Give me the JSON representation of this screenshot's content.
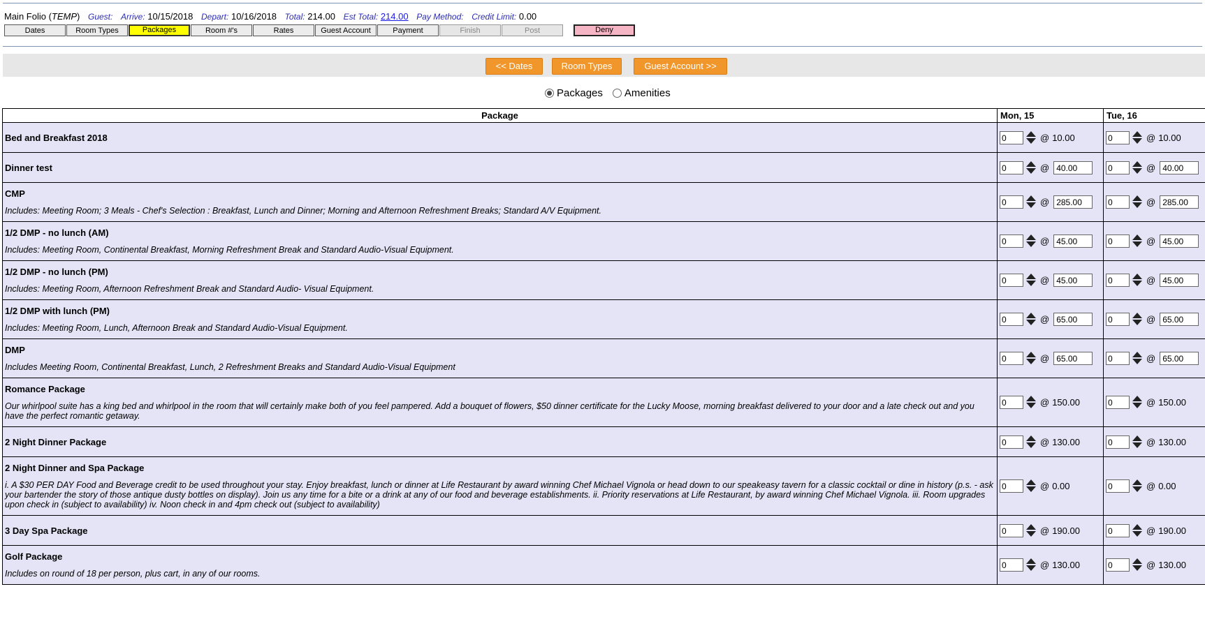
{
  "header": {
    "folio": "Main Folio",
    "folio_type": "TEMP",
    "guest_label": "Guest:",
    "guest_value": "",
    "arrive_label": "Arrive:",
    "arrive_value": "10/15/2018",
    "depart_label": "Depart:",
    "depart_value": "10/16/2018",
    "total_label": "Total:",
    "total_value": "214.00",
    "est_total_label": "Est Total:",
    "est_total_value": "214.00",
    "pay_method_label": "Pay Method:",
    "pay_method_value": "",
    "credit_limit_label": "Credit Limit:",
    "credit_limit_value": "0.00"
  },
  "nav_tabs": [
    {
      "label": "Dates",
      "state": "normal"
    },
    {
      "label": "Room Types",
      "state": "normal"
    },
    {
      "label": "Packages",
      "state": "active"
    },
    {
      "label": "Room #'s",
      "state": "normal"
    },
    {
      "label": "Rates",
      "state": "normal"
    },
    {
      "label": "Guest Account",
      "state": "normal"
    },
    {
      "label": "Payment",
      "state": "normal"
    },
    {
      "label": "Finish",
      "state": "disabled"
    },
    {
      "label": "Post",
      "state": "disabled"
    },
    {
      "label": "Deny",
      "state": "deny"
    }
  ],
  "buttons": {
    "prev": "<< Dates",
    "room_types": "Room Types",
    "next": "Guest Account >>"
  },
  "mode": {
    "options": [
      "Packages",
      "Amenities"
    ],
    "selected": "Packages"
  },
  "table": {
    "columns": [
      "Package",
      "Mon, 15",
      "Tue, 16"
    ],
    "rows": [
      {
        "name": "Bed and Breakfast 2018",
        "desc": "",
        "editable": false,
        "days": [
          {
            "qty": "0",
            "price": "10.00"
          },
          {
            "qty": "0",
            "price": "10.00"
          }
        ]
      },
      {
        "name": "Dinner test",
        "desc": "",
        "editable": true,
        "days": [
          {
            "qty": "0",
            "price": "40.00"
          },
          {
            "qty": "0",
            "price": "40.00"
          }
        ]
      },
      {
        "name": "CMP",
        "desc": "Includes: Meeting Room; 3 Meals - Chef's Selection : Breakfast, Lunch and Dinner; Morning and Afternoon Refreshment Breaks; Standard A/V Equipment.",
        "editable": true,
        "days": [
          {
            "qty": "0",
            "price": "285.00"
          },
          {
            "qty": "0",
            "price": "285.00"
          }
        ]
      },
      {
        "name": "1/2 DMP - no lunch (AM)",
        "desc": "Includes: Meeting Room, Continental Breakfast, Morning Refreshment Break and Standard Audio-Visual Equipment.",
        "editable": true,
        "days": [
          {
            "qty": "0",
            "price": "45.00"
          },
          {
            "qty": "0",
            "price": "45.00"
          }
        ]
      },
      {
        "name": "1/2 DMP - no lunch (PM)",
        "desc": "Includes: Meeting Room, Afternoon Refreshment Break and Standard Audio- Visual Equipment.",
        "editable": true,
        "days": [
          {
            "qty": "0",
            "price": "45.00"
          },
          {
            "qty": "0",
            "price": "45.00"
          }
        ]
      },
      {
        "name": "1/2 DMP with lunch (PM)",
        "desc": "Includes: Meeting Room, Lunch, Afternoon Break and Standard Audio-Visual Equipment.",
        "editable": true,
        "days": [
          {
            "qty": "0",
            "price": "65.00"
          },
          {
            "qty": "0",
            "price": "65.00"
          }
        ]
      },
      {
        "name": "DMP",
        "desc": "Includes Meeting Room, Continental Breakfast, Lunch, 2 Refreshment Breaks and Standard Audio-Visual Equipment",
        "editable": true,
        "days": [
          {
            "qty": "0",
            "price": "65.00"
          },
          {
            "qty": "0",
            "price": "65.00"
          }
        ]
      },
      {
        "name": "Romance Package",
        "desc": "Our whirlpool suite has a king bed and whirlpool in the room that will certainly make both of you feel pampered. Add a bouquet of flowers, $50 dinner certificate for the Lucky Moose, morning breakfast delivered to your door and a late check out and you have the perfect romantic getaway.",
        "editable": false,
        "days": [
          {
            "qty": "0",
            "price": "150.00"
          },
          {
            "qty": "0",
            "price": "150.00"
          }
        ]
      },
      {
        "name": "2 Night Dinner Package",
        "desc": "",
        "editable": false,
        "days": [
          {
            "qty": "0",
            "price": "130.00"
          },
          {
            "qty": "0",
            "price": "130.00"
          }
        ]
      },
      {
        "name": "2 Night Dinner and Spa Package",
        "desc": "i. A $30 PER DAY Food and Beverage credit to be used throughout your stay. Enjoy breakfast, lunch or dinner at Life Restaurant by award winning Chef Michael Vignola or head down to our speakeasy tavern for a classic cocktail or dine in history (p.s. - ask your bartender the story of those antique dusty bottles on display). Join us any time for a bite or a drink at any of our food and beverage establishments. ii. Priority reservations at Life Restaurant, by award winning Chef Michael Vignola. iii. Room upgrades upon check in (subject to availability) iv. Noon check in and 4pm check out (subject to availability)",
        "editable": false,
        "days": [
          {
            "qty": "0",
            "price": "0.00"
          },
          {
            "qty": "0",
            "price": "0.00"
          }
        ]
      },
      {
        "name": "3 Day Spa Package",
        "desc": "",
        "editable": false,
        "days": [
          {
            "qty": "0",
            "price": "190.00"
          },
          {
            "qty": "0",
            "price": "190.00"
          }
        ]
      },
      {
        "name": "Golf Package",
        "desc": "Includes on round of 18 per person, plus cart, in any of our rooms.",
        "editable": false,
        "days": [
          {
            "qty": "0",
            "price": "130.00"
          },
          {
            "qty": "0",
            "price": "130.00"
          }
        ]
      }
    ]
  },
  "colors": {
    "accent_button": "#f0962a",
    "active_tab": "#ffff00",
    "deny_tab": "#f5b5c5",
    "row_bg": "#e4e4f6"
  }
}
